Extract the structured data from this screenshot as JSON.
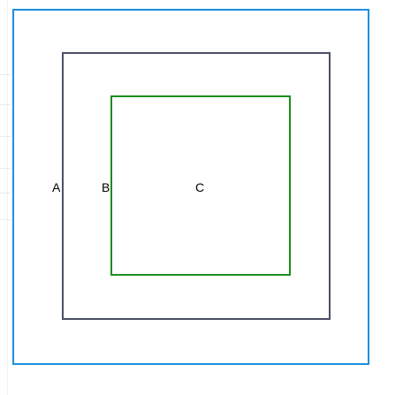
{
  "boxes": [
    {
      "id": "A",
      "label": "A",
      "border_color": "#1e8fe0"
    },
    {
      "id": "B",
      "label": "B",
      "border_color": "#4a5066"
    },
    {
      "id": "C",
      "label": "C",
      "border_color": "#1a8f1a"
    }
  ]
}
